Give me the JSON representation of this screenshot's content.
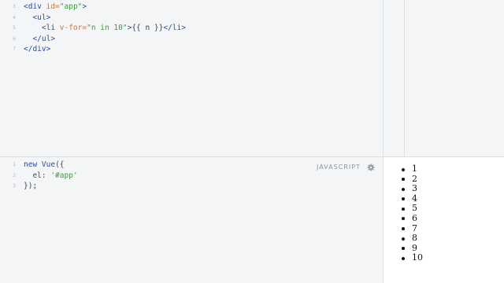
{
  "html_editor": {
    "lines": [
      {
        "no": "3",
        "tokens": [
          {
            "t": "<div ",
            "c": "tag"
          },
          {
            "t": "id=",
            "c": "attr"
          },
          {
            "t": "\"app\"",
            "c": "str"
          },
          {
            "t": ">",
            "c": "tag"
          }
        ]
      },
      {
        "no": "4",
        "tokens": [
          {
            "t": "  <ul>",
            "c": "tag"
          }
        ]
      },
      {
        "no": "5",
        "tokens": [
          {
            "t": "    <li ",
            "c": "tag"
          },
          {
            "t": "v-for=",
            "c": "attr"
          },
          {
            "t": "\"n in 10\"",
            "c": "str"
          },
          {
            "t": ">",
            "c": "tag"
          },
          {
            "t": "{{ n }}",
            "c": "punct"
          },
          {
            "t": "</li>",
            "c": "tag"
          }
        ]
      },
      {
        "no": "6",
        "tokens": [
          {
            "t": "  </ul>",
            "c": "tag"
          }
        ]
      },
      {
        "no": "7",
        "tokens": [
          {
            "t": "</div>",
            "c": "tag"
          }
        ]
      }
    ]
  },
  "js_editor": {
    "language_label": "JAVASCRIPT",
    "settings_icon": "gear-icon",
    "lines": [
      {
        "no": "1",
        "tokens": [
          {
            "t": "new ",
            "c": "kw"
          },
          {
            "t": "Vue",
            "c": "kw"
          },
          {
            "t": "({",
            "c": "punct"
          }
        ]
      },
      {
        "no": "2",
        "tokens": [
          {
            "t": "  el: ",
            "c": "prop"
          },
          {
            "t": "'#app'",
            "c": "str"
          }
        ]
      },
      {
        "no": "3",
        "tokens": [
          {
            "t": "});",
            "c": "punct"
          }
        ]
      }
    ]
  },
  "output": {
    "items": [
      "1",
      "2",
      "3",
      "4",
      "5",
      "6",
      "7",
      "8",
      "9",
      "10"
    ]
  },
  "colors": {
    "tag": "#2d4f98",
    "attribute": "#d1703e",
    "string": "#3f9a3f",
    "background": "#f4f5f6"
  }
}
